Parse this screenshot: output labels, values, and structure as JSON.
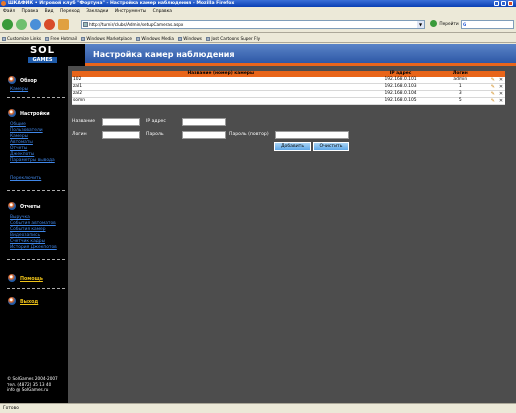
{
  "browser": {
    "window_title": "ШКАФИК • Игровой клуб \"Фортуна\" - Настройка камер наблюдения - Mozilla Firefox",
    "menu": [
      "Файл",
      "Правка",
      "Вид",
      "Переход",
      "Закладки",
      "Инструменты",
      "Справка"
    ],
    "address": "http://turnir/clubs/Admin/setupCameras.aspx",
    "go_label": "Перейти",
    "search_engine": "G",
    "bookmarks": [
      "Customize Links",
      "Free Hotmail",
      "Windows Marketplace",
      "Windows Media",
      "Windows",
      "Jost Cartoons Super Fly"
    ],
    "status": "Готово"
  },
  "brand": {
    "logo_top": "SOL",
    "logo_bottom": "GAMES"
  },
  "header": {
    "title": "Настройка камер наблюдения"
  },
  "sidebar": {
    "overview": {
      "title": "Обзор",
      "links": [
        "Камеры"
      ]
    },
    "settings": {
      "title": "Настройки",
      "links": [
        "Общие",
        "Пользователи",
        "Камеры",
        "Автоматы",
        "Отчеты",
        "Джекпоты",
        "Параметры вывода"
      ],
      "extra_link": "Переключить"
    },
    "reports": {
      "title": "Отчеты",
      "links": [
        "Выручка",
        "События автоматов",
        "События камер",
        "Видеозапись",
        "Счетчик кадры",
        "История Джекпотов"
      ]
    },
    "help": "Помощь",
    "exit": "Выход",
    "copyright": [
      "© SolGames 2004-2007",
      "тел. (4872) 35 13 40",
      "info @ SolGames.ru"
    ]
  },
  "table": {
    "headers": [
      "Название (номер) камеры",
      "IP адрес",
      "Логин"
    ],
    "rows": [
      {
        "name": "102",
        "ip": "192.168.0.101",
        "login": "admin"
      },
      {
        "name": "zal1",
        "ip": "192.168.0.103",
        "login": "1"
      },
      {
        "name": "zal2",
        "ip": "192.168.0.104",
        "login": "3"
      },
      {
        "name": "somn",
        "ip": "192.168.0.105",
        "login": "5"
      }
    ]
  },
  "form": {
    "name_label": "Название",
    "ip_label": "IP адрес",
    "login_label": "Логин",
    "password_label": "Пароль",
    "password_repeat_label": "Пароль (повтор)",
    "add_button": "Добавить",
    "clear_button": "Очистить"
  },
  "colors": {
    "accent": "#e8651a",
    "header_blue": "#2e58a6",
    "link": "#3f86e8",
    "background": "#4d4d4d"
  }
}
